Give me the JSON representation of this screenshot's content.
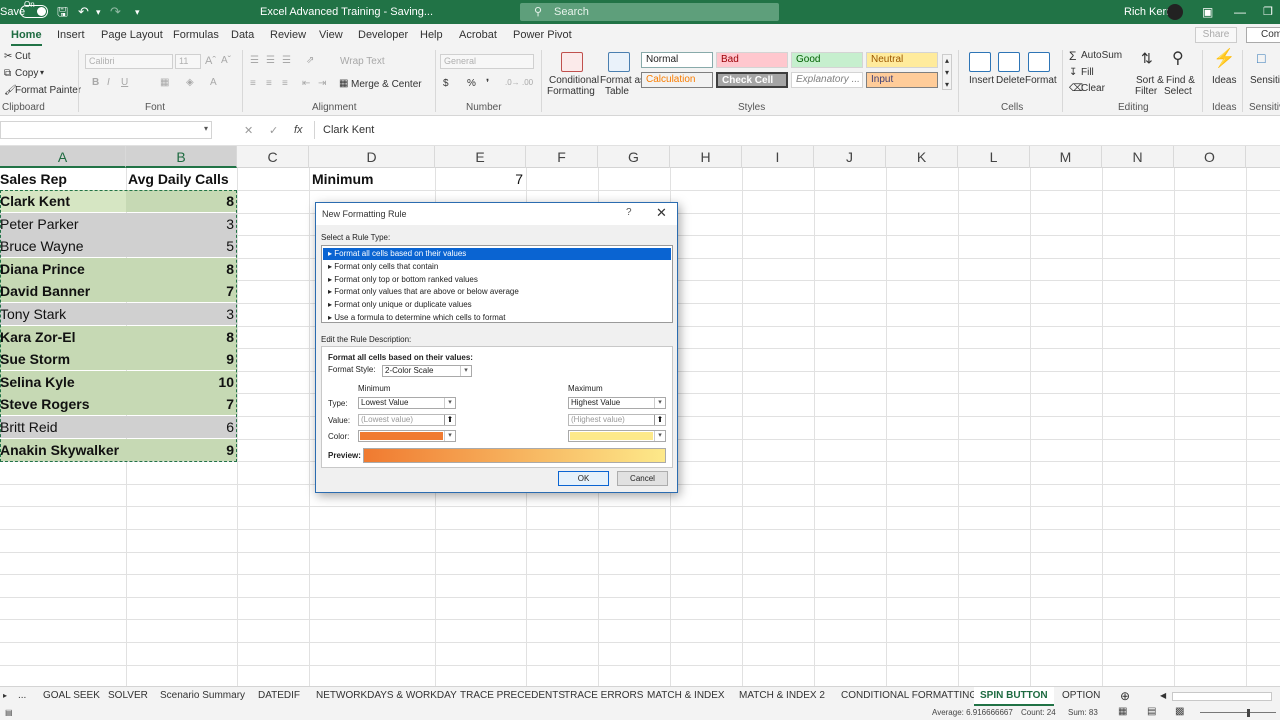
{
  "titlebar": {
    "autosave_label": "Save",
    "toggle_label": "On",
    "document_title": "Excel Advanced Training  -  Saving...",
    "search_placeholder": "Search",
    "user_name": "Rich Kerr"
  },
  "ribbon_tabs": [
    "Home",
    "Insert",
    "Page Layout",
    "Formulas",
    "Data",
    "Review",
    "View",
    "Developer",
    "Help",
    "Acrobat",
    "Power Pivot"
  ],
  "ribbon": {
    "share_label": "Share",
    "comments_label": "Com",
    "clipboard": {
      "cut": "Cut",
      "copy": "Copy",
      "format_painter": "Format Painter",
      "group": "Clipboard"
    },
    "font": {
      "name": "Calibri",
      "size": "11",
      "group": "Font"
    },
    "alignment": {
      "wrap_text": "Wrap Text",
      "merge_center": "Merge & Center",
      "group": "Alignment"
    },
    "number": {
      "format": "General",
      "group": "Number"
    },
    "styles": {
      "conditional_formatting": [
        "Conditional",
        "Formatting"
      ],
      "format_as_table": [
        "Format as",
        "Table"
      ],
      "cells": [
        "Normal",
        "Bad",
        "Good",
        "Neutral",
        "Calculation",
        "Check Cell",
        "Explanatory ...",
        "Input"
      ],
      "group": "Styles"
    },
    "cells_group": {
      "insert": "Insert",
      "delete": "Delete",
      "format": "Format",
      "group": "Cells"
    },
    "editing": {
      "autosum": "AutoSum",
      "fill": "Fill",
      "clear": "Clear",
      "sort_filter": [
        "Sort &",
        "Filter"
      ],
      "find_select": [
        "Find &",
        "Select"
      ],
      "group": "Editing"
    },
    "ideas": {
      "label": "Ideas",
      "group": "Ideas"
    },
    "sensitivity": {
      "label": "Sensitivi",
      "group": "Sensitivi"
    }
  },
  "formula_bar": {
    "value": "Clark Kent"
  },
  "columns": [
    "A",
    "B",
    "C",
    "D",
    "E",
    "F",
    "G",
    "H",
    "I",
    "J",
    "K",
    "L",
    "M",
    "N",
    "O"
  ],
  "sheet": {
    "header_rep": "Sales Rep",
    "header_calls": "Avg Daily Calls",
    "min_label": "Minimum",
    "min_value": "7",
    "rows": [
      {
        "name": "Clark Kent",
        "calls": "8"
      },
      {
        "name": "Peter Parker",
        "calls": "3"
      },
      {
        "name": "Bruce Wayne",
        "calls": "5"
      },
      {
        "name": "Diana Prince",
        "calls": "8"
      },
      {
        "name": "David Banner",
        "calls": "7"
      },
      {
        "name": "Tony Stark",
        "calls": "3"
      },
      {
        "name": "Kara Zor-El",
        "calls": "8"
      },
      {
        "name": "Sue Storm",
        "calls": "9"
      },
      {
        "name": "Selina Kyle",
        "calls": "10"
      },
      {
        "name": "Steve Rogers",
        "calls": "7"
      },
      {
        "name": "Britt Reid",
        "calls": "6"
      },
      {
        "name": "Anakin Skywalker",
        "calls": "9"
      }
    ]
  },
  "dialog": {
    "title": "New Formatting Rule",
    "help": "?",
    "select_rule_label": "Select a Rule Type:",
    "rules": [
      "Format all cells based on their values",
      "Format only cells that contain",
      "Format only top or bottom ranked values",
      "Format only values that are above or below average",
      "Format only unique or duplicate values",
      "Use a formula to determine which cells to format"
    ],
    "edit_label": "Edit the Rule Description:",
    "desc_heading": "Format all cells based on their values:",
    "format_style_label": "Format Style:",
    "format_style_value": "2-Color Scale",
    "minimum_label": "Minimum",
    "maximum_label": "Maximum",
    "type_label": "Type:",
    "value_label": "Value:",
    "color_label": "Color:",
    "min_type": "Lowest Value",
    "max_type": "Highest Value",
    "min_value_placeholder": "(Lowest value)",
    "max_value_placeholder": "(Highest value)",
    "min_color": "#f07a30",
    "max_color": "#fde98a",
    "preview_label": "Preview:",
    "ok": "OK",
    "cancel": "Cancel"
  },
  "sheet_tabs": [
    "...",
    "GOAL SEEK",
    "SOLVER",
    "Scenario Summary",
    "DATEDIF",
    "NETWORKDAYS & WORKDAY",
    "TRACE PRECEDENTS",
    "TRACE ERRORS",
    "MATCH & INDEX",
    "MATCH & INDEX 2",
    "CONDITIONAL FORMATTING",
    "SPIN BUTTON",
    "OPTION"
  ],
  "status": {
    "average": "Average: 6.916666667",
    "count": "Count: 24",
    "sum": "Sum: 83"
  },
  "colors": {
    "excel_green": "#217346",
    "cell_green": "#c6d9b4",
    "cell_gray": "#d0d0d0",
    "selected_rule": "#0a64d2"
  }
}
